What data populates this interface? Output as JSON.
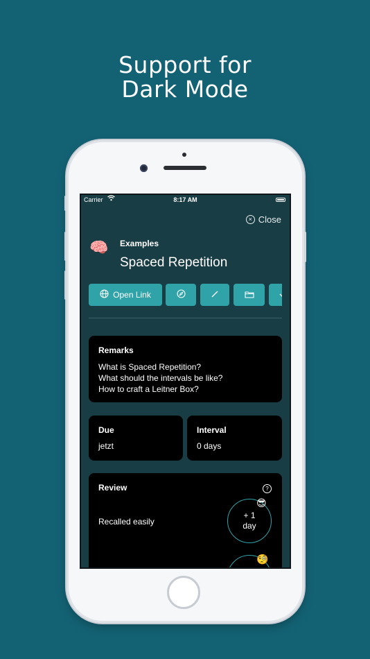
{
  "headline": {
    "line1": "Support for",
    "line2": "Dark Mode"
  },
  "status_bar": {
    "carrier": "Carrier",
    "time": "8:17 AM"
  },
  "header": {
    "close_label": "Close",
    "deck": "Examples",
    "title": "Spaced Repetition",
    "deck_icon": "brain-icon"
  },
  "actions": {
    "open_link_label": "Open Link"
  },
  "remarks": {
    "heading": "Remarks",
    "lines": [
      "What is Spaced Repetition?",
      "What should the intervals be like?",
      "How to craft a Leitner Box?"
    ]
  },
  "due": {
    "heading": "Due",
    "value": "jetzt"
  },
  "interval": {
    "heading": "Interval",
    "value": "0 days"
  },
  "review": {
    "heading": "Review",
    "option1": {
      "label": "Recalled easily",
      "interval_line1": "+ 1",
      "interval_line2": "day",
      "emoji": "😎"
    },
    "option2": {
      "emoji": "🧐"
    }
  },
  "colors": {
    "background": "#136274",
    "screen": "#193d45",
    "accent": "#2fa3a8",
    "panel": "#000000"
  }
}
